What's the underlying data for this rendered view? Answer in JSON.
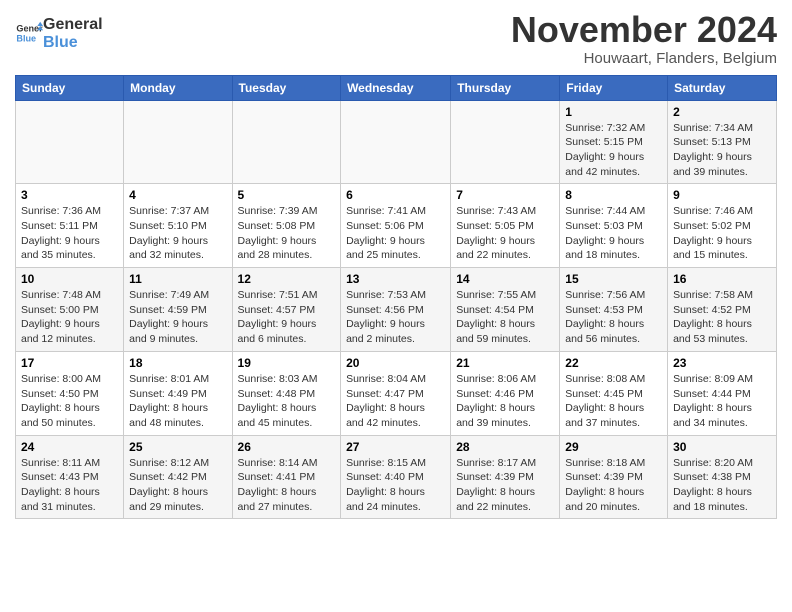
{
  "logo": {
    "line1": "General",
    "line2": "Blue"
  },
  "title": "November 2024",
  "location": "Houwaart, Flanders, Belgium",
  "days_header": [
    "Sunday",
    "Monday",
    "Tuesday",
    "Wednesday",
    "Thursday",
    "Friday",
    "Saturday"
  ],
  "weeks": [
    [
      {
        "day": "",
        "info": ""
      },
      {
        "day": "",
        "info": ""
      },
      {
        "day": "",
        "info": ""
      },
      {
        "day": "",
        "info": ""
      },
      {
        "day": "",
        "info": ""
      },
      {
        "day": "1",
        "info": "Sunrise: 7:32 AM\nSunset: 5:15 PM\nDaylight: 9 hours and 42 minutes."
      },
      {
        "day": "2",
        "info": "Sunrise: 7:34 AM\nSunset: 5:13 PM\nDaylight: 9 hours and 39 minutes."
      }
    ],
    [
      {
        "day": "3",
        "info": "Sunrise: 7:36 AM\nSunset: 5:11 PM\nDaylight: 9 hours and 35 minutes."
      },
      {
        "day": "4",
        "info": "Sunrise: 7:37 AM\nSunset: 5:10 PM\nDaylight: 9 hours and 32 minutes."
      },
      {
        "day": "5",
        "info": "Sunrise: 7:39 AM\nSunset: 5:08 PM\nDaylight: 9 hours and 28 minutes."
      },
      {
        "day": "6",
        "info": "Sunrise: 7:41 AM\nSunset: 5:06 PM\nDaylight: 9 hours and 25 minutes."
      },
      {
        "day": "7",
        "info": "Sunrise: 7:43 AM\nSunset: 5:05 PM\nDaylight: 9 hours and 22 minutes."
      },
      {
        "day": "8",
        "info": "Sunrise: 7:44 AM\nSunset: 5:03 PM\nDaylight: 9 hours and 18 minutes."
      },
      {
        "day": "9",
        "info": "Sunrise: 7:46 AM\nSunset: 5:02 PM\nDaylight: 9 hours and 15 minutes."
      }
    ],
    [
      {
        "day": "10",
        "info": "Sunrise: 7:48 AM\nSunset: 5:00 PM\nDaylight: 9 hours and 12 minutes."
      },
      {
        "day": "11",
        "info": "Sunrise: 7:49 AM\nSunset: 4:59 PM\nDaylight: 9 hours and 9 minutes."
      },
      {
        "day": "12",
        "info": "Sunrise: 7:51 AM\nSunset: 4:57 PM\nDaylight: 9 hours and 6 minutes."
      },
      {
        "day": "13",
        "info": "Sunrise: 7:53 AM\nSunset: 4:56 PM\nDaylight: 9 hours and 2 minutes."
      },
      {
        "day": "14",
        "info": "Sunrise: 7:55 AM\nSunset: 4:54 PM\nDaylight: 8 hours and 59 minutes."
      },
      {
        "day": "15",
        "info": "Sunrise: 7:56 AM\nSunset: 4:53 PM\nDaylight: 8 hours and 56 minutes."
      },
      {
        "day": "16",
        "info": "Sunrise: 7:58 AM\nSunset: 4:52 PM\nDaylight: 8 hours and 53 minutes."
      }
    ],
    [
      {
        "day": "17",
        "info": "Sunrise: 8:00 AM\nSunset: 4:50 PM\nDaylight: 8 hours and 50 minutes."
      },
      {
        "day": "18",
        "info": "Sunrise: 8:01 AM\nSunset: 4:49 PM\nDaylight: 8 hours and 48 minutes."
      },
      {
        "day": "19",
        "info": "Sunrise: 8:03 AM\nSunset: 4:48 PM\nDaylight: 8 hours and 45 minutes."
      },
      {
        "day": "20",
        "info": "Sunrise: 8:04 AM\nSunset: 4:47 PM\nDaylight: 8 hours and 42 minutes."
      },
      {
        "day": "21",
        "info": "Sunrise: 8:06 AM\nSunset: 4:46 PM\nDaylight: 8 hours and 39 minutes."
      },
      {
        "day": "22",
        "info": "Sunrise: 8:08 AM\nSunset: 4:45 PM\nDaylight: 8 hours and 37 minutes."
      },
      {
        "day": "23",
        "info": "Sunrise: 8:09 AM\nSunset: 4:44 PM\nDaylight: 8 hours and 34 minutes."
      }
    ],
    [
      {
        "day": "24",
        "info": "Sunrise: 8:11 AM\nSunset: 4:43 PM\nDaylight: 8 hours and 31 minutes."
      },
      {
        "day": "25",
        "info": "Sunrise: 8:12 AM\nSunset: 4:42 PM\nDaylight: 8 hours and 29 minutes."
      },
      {
        "day": "26",
        "info": "Sunrise: 8:14 AM\nSunset: 4:41 PM\nDaylight: 8 hours and 27 minutes."
      },
      {
        "day": "27",
        "info": "Sunrise: 8:15 AM\nSunset: 4:40 PM\nDaylight: 8 hours and 24 minutes."
      },
      {
        "day": "28",
        "info": "Sunrise: 8:17 AM\nSunset: 4:39 PM\nDaylight: 8 hours and 22 minutes."
      },
      {
        "day": "29",
        "info": "Sunrise: 8:18 AM\nSunset: 4:39 PM\nDaylight: 8 hours and 20 minutes."
      },
      {
        "day": "30",
        "info": "Sunrise: 8:20 AM\nSunset: 4:38 PM\nDaylight: 8 hours and 18 minutes."
      }
    ]
  ]
}
